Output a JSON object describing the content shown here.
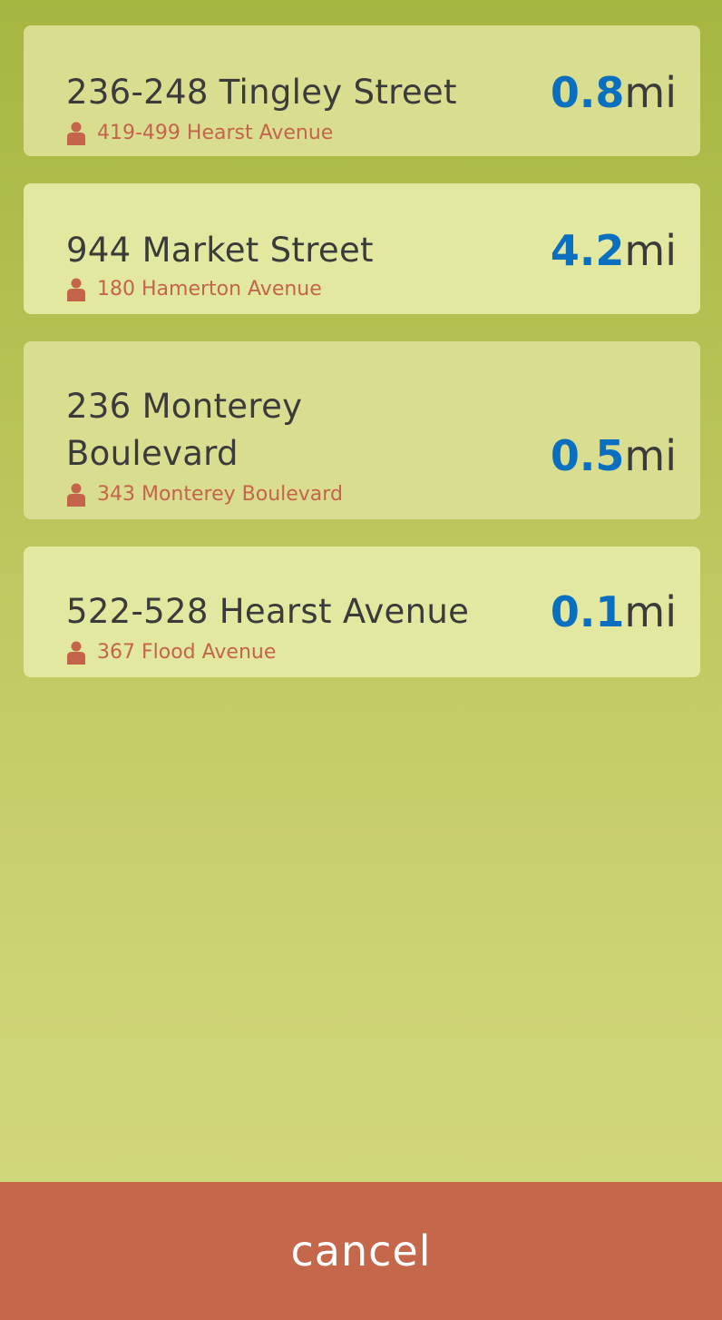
{
  "results": [
    {
      "address": "236-248 Tingley Street",
      "nearby": "419-499 Hearst Avenue",
      "distance_value": "0.8",
      "distance_unit": "mi"
    },
    {
      "address": "944 Market Street",
      "nearby": "180 Hamerton Avenue",
      "distance_value": "4.2",
      "distance_unit": "mi"
    },
    {
      "address": "236 Monterey Boulevard",
      "nearby": "343 Monterey Boulevard",
      "distance_value": "0.5",
      "distance_unit": "mi"
    },
    {
      "address": "522-528 Hearst Avenue",
      "nearby": "367 Flood Avenue",
      "distance_value": "0.1",
      "distance_unit": "mi"
    }
  ],
  "icons": {
    "nearby": "person-icon"
  },
  "colors": {
    "background_top": "#a6b641",
    "background_bottom": "#d3d97e",
    "card": "#d9dd8f",
    "card_alt": "#e3e8a0",
    "distance": "#0a6fbf",
    "nearby_text": "#c4644a",
    "cancel_bar": "#c5674a"
  },
  "footer": {
    "cancel_label": "cancel"
  }
}
